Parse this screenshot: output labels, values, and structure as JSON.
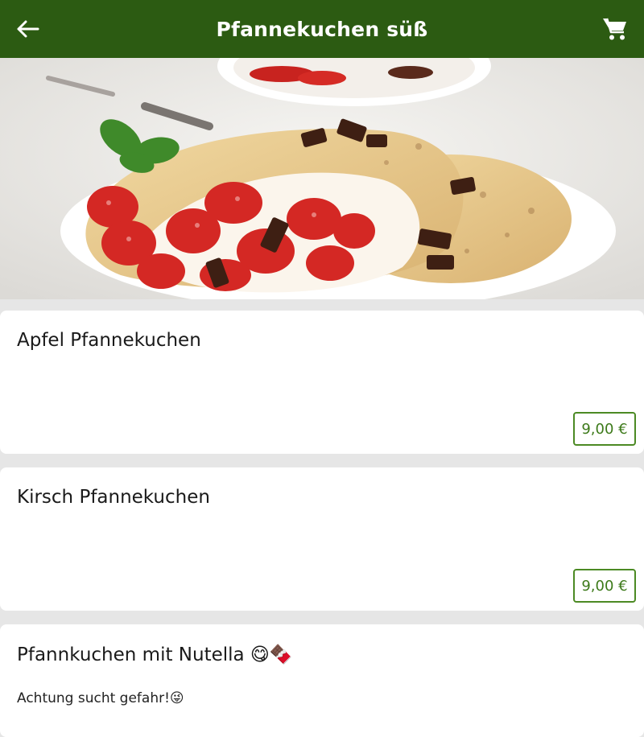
{
  "header": {
    "title": "Pfannekuchen süß",
    "back_icon": "arrow-left-icon",
    "cart_icon": "shopping-cart-icon",
    "bar_color": "#2c5b12"
  },
  "hero": {
    "image": "crepe-with-strawberries-photo"
  },
  "products": [
    {
      "name": "Apfel Pfannekuchen",
      "description": "",
      "price": "9,00 €"
    },
    {
      "name": "Kirsch Pfannekuchen",
      "description": "",
      "price": "9,00 €"
    },
    {
      "name": "Pfannkuchen mit Nutella 😋🍫",
      "description": "Achtung sucht gefahr!😜",
      "price": ""
    }
  ],
  "colors": {
    "accent": "#4c8a24",
    "background": "#e6e6e6",
    "card": "#ffffff"
  }
}
